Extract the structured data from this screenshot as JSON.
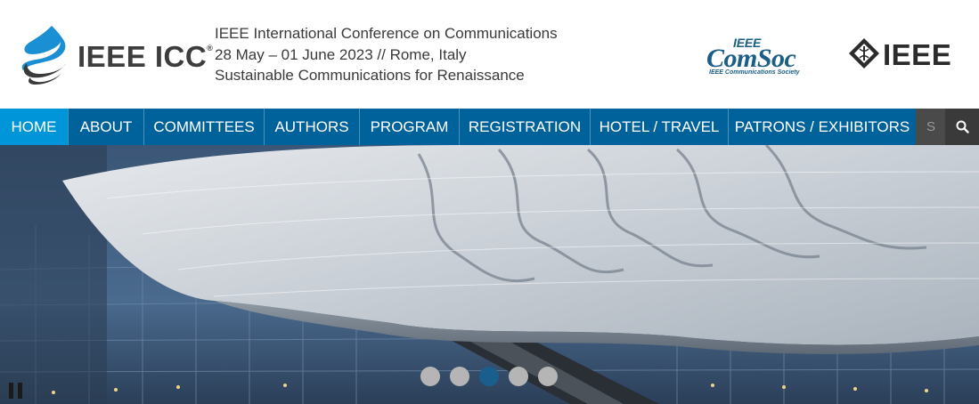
{
  "header": {
    "logo_text": "IEEE ICC",
    "logo_reg": "®",
    "conference_name": "IEEE International Conference on Communications",
    "dates_location": "28 May – 01 June 2023 // Rome, Italy",
    "theme": "Sustainable Communications for Renaissance",
    "comsoc_top": "IEEE",
    "comsoc_main": "ComSoc",
    "comsoc_sub": "IEEE Communications Society",
    "ieee_text": "IEEE"
  },
  "nav": {
    "items": [
      {
        "label": "HOME",
        "active": true
      },
      {
        "label": "ABOUT"
      },
      {
        "label": "COMMITTEES"
      },
      {
        "label": "AUTHORS"
      },
      {
        "label": "PROGRAM"
      },
      {
        "label": "REGISTRATION"
      },
      {
        "label": "HOTEL / TRAVEL"
      },
      {
        "label": "PATRONS / EXHIBITORS"
      }
    ],
    "search_stub": "S",
    "search_icon": "magnifier-icon"
  },
  "slider": {
    "slide_count": 5,
    "active_slide": 3,
    "pause_icon": "pause-icon"
  },
  "colors": {
    "nav_bg": "#00629b",
    "nav_active": "#0095d9",
    "search_bg": "#3a3a3a",
    "dot_active": "#1a5e8e",
    "dot_inactive": "#b5b5b5"
  }
}
